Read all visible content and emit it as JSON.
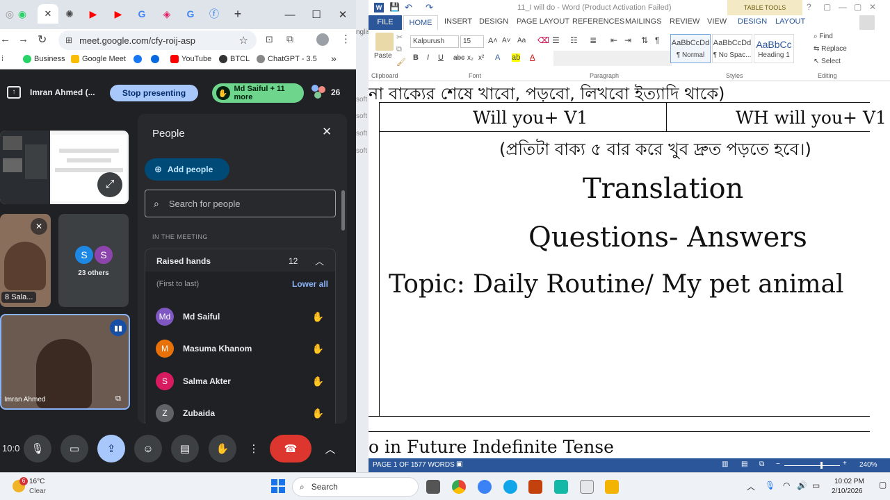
{
  "browser": {
    "url": "meet.google.com/cfy-roij-asp",
    "bookmarks": [
      "Business",
      "Google Meet",
      "YouTube",
      "BTCL",
      "ChatGPT - 3.5"
    ],
    "more_bookmarks": "»"
  },
  "meet": {
    "presenter_name": "Imran Ahmed (...",
    "stop_presenting": "Stop presenting",
    "raised_chip": "Md Saiful + 11 more",
    "participant_count": "26",
    "tiles": {
      "others_label": "23 others",
      "others_avatars": [
        "S",
        "S"
      ],
      "self_name": "Imran Ahmed",
      "small_name": "Sala...",
      "small_count": "8"
    },
    "clock_partial": "10:0",
    "people": {
      "title": "People",
      "add_people": "Add people",
      "search_placeholder": "Search for people",
      "section": "IN THE MEETING",
      "raised_hands_label": "Raised hands",
      "raised_hands_count": "12",
      "order_note": "(First to last)",
      "lower_all": "Lower all",
      "list": [
        {
          "initials": "Md",
          "name": "Md Saiful",
          "color": "#7e57c2"
        },
        {
          "initials": "M",
          "name": "Masuma Khanom",
          "color": "#e8710a"
        },
        {
          "initials": "S",
          "name": "Salma Akter",
          "color": "#d81b60"
        },
        {
          "initials": "Z",
          "name": "Zubaida",
          "color": "#5f6368"
        }
      ]
    }
  },
  "word": {
    "title": "11_I will do - Word (Product Activation Failed)",
    "table_tools": "TABLE TOOLS",
    "tabs": [
      "FILE",
      "HOME",
      "INSERT",
      "DESIGN",
      "PAGE LAYOUT",
      "REFERENCES",
      "MAILINGS",
      "REVIEW",
      "VIEW",
      "DESIGN",
      "LAYOUT"
    ],
    "font_name": "Kalpurush",
    "font_size": "15",
    "groups": [
      "Clipboard",
      "Font",
      "Paragraph",
      "Styles",
      "Editing"
    ],
    "paste": "Paste",
    "styles": [
      {
        "preview": "AaBbCcDd",
        "name": "¶ Normal"
      },
      {
        "preview": "AaBbCcDd",
        "name": "¶ No Spac..."
      },
      {
        "preview": "AaBbCc",
        "name": "Heading 1"
      }
    ],
    "editing": [
      "Find",
      "Replace",
      "Select"
    ],
    "doc": {
      "top_bengali": "না বাক্যের শেষে খাবো, পড়বো, লিখবো ইত্যাদি থাকে)",
      "cell_left": "Will you+ V1",
      "cell_right": "WH will you+ V1",
      "instruction": "(প্রতিটা বাক্য ৫ বার করে খুব দ্রুত পড়তে হবে।)",
      "heading1": "Translation",
      "heading2": "Questions- Answers",
      "topic": "Topic: Daily Routine/ My pet animal",
      "bottom": "o in Future Indefinite Tense"
    },
    "status": {
      "page": "PAGE 1 OF 1",
      "words": "577 WORDS",
      "zoom": "240%"
    },
    "side_snips": [
      "soft",
      "soft",
      "soft",
      "soft"
    ],
    "side_snip_top": "nglis"
  },
  "taskbar": {
    "weather_temp": "16°C",
    "weather_desc": "Clear",
    "weather_badge": "6",
    "search": "Search",
    "time": "10:02 PM",
    "date": "2/10/2026"
  }
}
